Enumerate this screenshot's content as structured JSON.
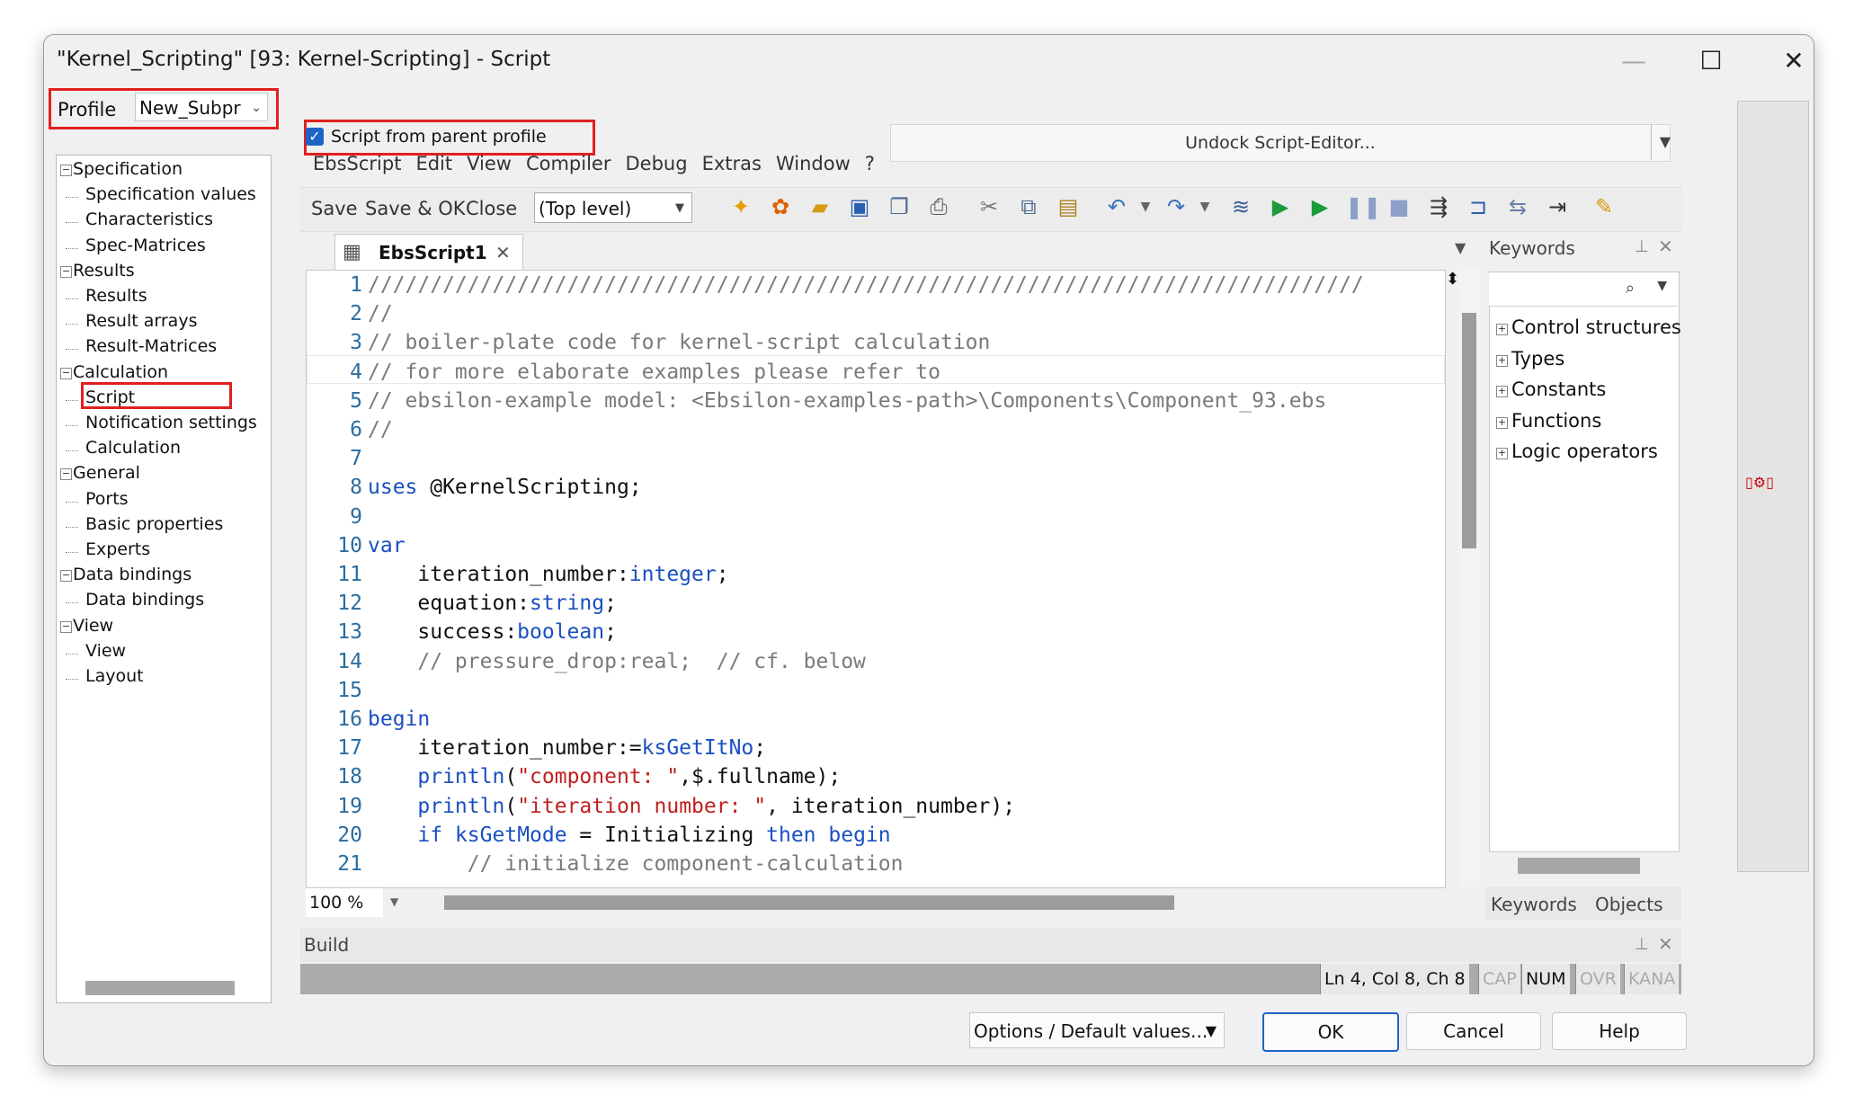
{
  "window": {
    "title": "\"Kernel_Scripting\" [93: Kernel-Scripting] - Script",
    "minimize_glyph": "—",
    "maximize_glyph": "☐",
    "close_glyph": "✕"
  },
  "profile": {
    "label": "Profile",
    "value": "New_Subpr"
  },
  "tree": [
    {
      "label": "Specification",
      "level": 0,
      "expander": "−"
    },
    {
      "label": "Specification values",
      "level": 1
    },
    {
      "label": "Characteristics",
      "level": 1
    },
    {
      "label": "Spec-Matrices",
      "level": 1
    },
    {
      "label": "Results",
      "level": 0,
      "expander": "−"
    },
    {
      "label": "Results",
      "level": 1
    },
    {
      "label": "Result arrays",
      "level": 1
    },
    {
      "label": "Result-Matrices",
      "level": 1
    },
    {
      "label": "Calculation",
      "level": 0,
      "expander": "−"
    },
    {
      "label": "Script",
      "level": 1,
      "selected": true
    },
    {
      "label": "Notification settings",
      "level": 1
    },
    {
      "label": "Calculation",
      "level": 1
    },
    {
      "label": "General",
      "level": 0,
      "expander": "−"
    },
    {
      "label": "Ports",
      "level": 1
    },
    {
      "label": "Basic properties",
      "level": 1
    },
    {
      "label": "Experts",
      "level": 1
    },
    {
      "label": "Data bindings",
      "level": 0,
      "expander": "−"
    },
    {
      "label": "Data bindings",
      "level": 1
    },
    {
      "label": "View",
      "level": 0,
      "expander": "−"
    },
    {
      "label": "View",
      "level": 1
    },
    {
      "label": "Layout",
      "level": 1
    }
  ],
  "script_from_parent": {
    "label": "Script from parent profile",
    "checked": true
  },
  "undock": {
    "label": "Undock Script-Editor..."
  },
  "menu": [
    "EbsScript",
    "Edit",
    "View",
    "Compiler",
    "Debug",
    "Extras",
    "Window",
    "?"
  ],
  "toolbar": {
    "save": "Save",
    "save_ok": "Save & OK",
    "close": "Close",
    "level": "(Top level)"
  },
  "editor": {
    "tab_label": "EbsScript1",
    "tab_close": "✕",
    "zoom": "100 %",
    "lines": [
      {
        "n": "1",
        "parts": [
          {
            "t": "////////////////////////////////////////////////////////////////////////////////",
            "c": "cm"
          }
        ]
      },
      {
        "n": "2",
        "parts": [
          {
            "t": "//",
            "c": "cm"
          }
        ]
      },
      {
        "n": "3",
        "parts": [
          {
            "t": "// boiler-plate code for kernel-script calculation",
            "c": "cm"
          }
        ]
      },
      {
        "n": "4",
        "parts": [
          {
            "t": "// for more elaborate examples please refer to",
            "c": "cm"
          }
        ]
      },
      {
        "n": "5",
        "parts": [
          {
            "t": "// ebsilon-example model: <Ebsilon-examples-path>\\Components\\Component_93.ebs",
            "c": "cm"
          }
        ]
      },
      {
        "n": "6",
        "parts": [
          {
            "t": "//",
            "c": "cm"
          }
        ]
      },
      {
        "n": "7",
        "parts": []
      },
      {
        "n": "8",
        "parts": [
          {
            "t": "uses",
            "c": "kw"
          },
          {
            "t": " @KernelScripting;",
            "c": ""
          }
        ]
      },
      {
        "n": "9",
        "parts": []
      },
      {
        "n": "10",
        "parts": [
          {
            "t": "var",
            "c": "kw"
          }
        ]
      },
      {
        "n": "11",
        "parts": [
          {
            "t": "    iteration_number:",
            "c": ""
          },
          {
            "t": "integer",
            "c": "kw"
          },
          {
            "t": ";",
            "c": ""
          }
        ]
      },
      {
        "n": "12",
        "parts": [
          {
            "t": "    equation:",
            "c": ""
          },
          {
            "t": "string",
            "c": "kw"
          },
          {
            "t": ";",
            "c": ""
          }
        ]
      },
      {
        "n": "13",
        "parts": [
          {
            "t": "    success:",
            "c": ""
          },
          {
            "t": "boolean",
            "c": "kw"
          },
          {
            "t": ";",
            "c": ""
          }
        ]
      },
      {
        "n": "14",
        "parts": [
          {
            "t": "    // pressure_drop:real;  // cf. below",
            "c": "cm"
          }
        ]
      },
      {
        "n": "15",
        "parts": []
      },
      {
        "n": "16",
        "parts": [
          {
            "t": "begin",
            "c": "kw"
          }
        ]
      },
      {
        "n": "17",
        "parts": [
          {
            "t": "    iteration_number:=",
            "c": ""
          },
          {
            "t": "ksGetItNo",
            "c": "kw"
          },
          {
            "t": ";",
            "c": ""
          }
        ]
      },
      {
        "n": "18",
        "parts": [
          {
            "t": "    ",
            "c": ""
          },
          {
            "t": "println",
            "c": "kw"
          },
          {
            "t": "(",
            "c": ""
          },
          {
            "t": "\"component: \"",
            "c": "str"
          },
          {
            "t": ",$.fullname);",
            "c": ""
          }
        ]
      },
      {
        "n": "19",
        "parts": [
          {
            "t": "    ",
            "c": ""
          },
          {
            "t": "println",
            "c": "kw"
          },
          {
            "t": "(",
            "c": ""
          },
          {
            "t": "\"iteration number: \"",
            "c": "str"
          },
          {
            "t": ", iteration_number);",
            "c": ""
          }
        ]
      },
      {
        "n": "20",
        "parts": [
          {
            "t": "    ",
            "c": ""
          },
          {
            "t": "if",
            "c": "kw"
          },
          {
            "t": " ",
            "c": ""
          },
          {
            "t": "ksGetMode",
            "c": "kw"
          },
          {
            "t": " = Initializing ",
            "c": ""
          },
          {
            "t": "then begin",
            "c": "kw"
          }
        ]
      },
      {
        "n": "21",
        "parts": [
          {
            "t": "        // initialize component-calculation",
            "c": "cm"
          }
        ]
      }
    ]
  },
  "keywords_panel": {
    "title": "Keywords",
    "items": [
      "Control structures",
      "Types",
      "Constants",
      "Functions",
      "Logic operators"
    ],
    "tabs": [
      "Keywords",
      "Objects"
    ]
  },
  "build_panel": {
    "title": "Build"
  },
  "status": {
    "position": "Ln 4, Col 8, Ch 8",
    "cap": "CAP",
    "num": "NUM",
    "ovr": "OVR",
    "kana": "KANA"
  },
  "buttons": {
    "options": "Options / Default values...",
    "ok": "OK",
    "cancel": "Cancel",
    "help": "Help"
  },
  "colors": {
    "accent": "#1f63c6",
    "highlight_red": "#e02020",
    "keyword": "#1a4fc0",
    "string": "#c02020",
    "comment": "#7a7a7a"
  }
}
